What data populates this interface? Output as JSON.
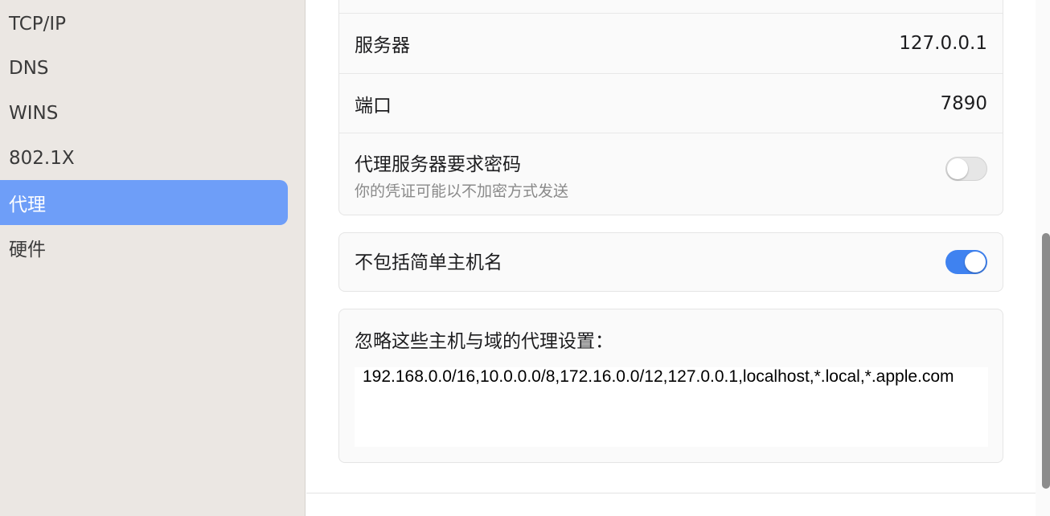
{
  "sidebar": {
    "items": [
      {
        "label": "TCP/IP"
      },
      {
        "label": "DNS"
      },
      {
        "label": "WINS"
      },
      {
        "label": "802.1X"
      },
      {
        "label": "代理",
        "active": true
      },
      {
        "label": "硬件"
      }
    ]
  },
  "proxy": {
    "server_label": "服务器",
    "server_value": "127.0.0.1",
    "port_label": "端口",
    "port_value": "7890",
    "password_label": "代理服务器要求密码",
    "password_sublabel": "你的凭证可能以不加密方式发送",
    "password_required": false
  },
  "exclude_simple": {
    "label": "不包括简单主机名",
    "enabled": true
  },
  "bypass": {
    "label": "忽略这些主机与域的代理设置：",
    "value": "192.168.0.0/16,10.0.0.0/8,172.16.0.0/12,127.0.0.1,localhost,*.local,*.apple.com"
  },
  "colors": {
    "accent": "#3f82f0",
    "sidebar_selected": "#6e9ef8",
    "sidebar_bg": "#ebe7e3"
  }
}
